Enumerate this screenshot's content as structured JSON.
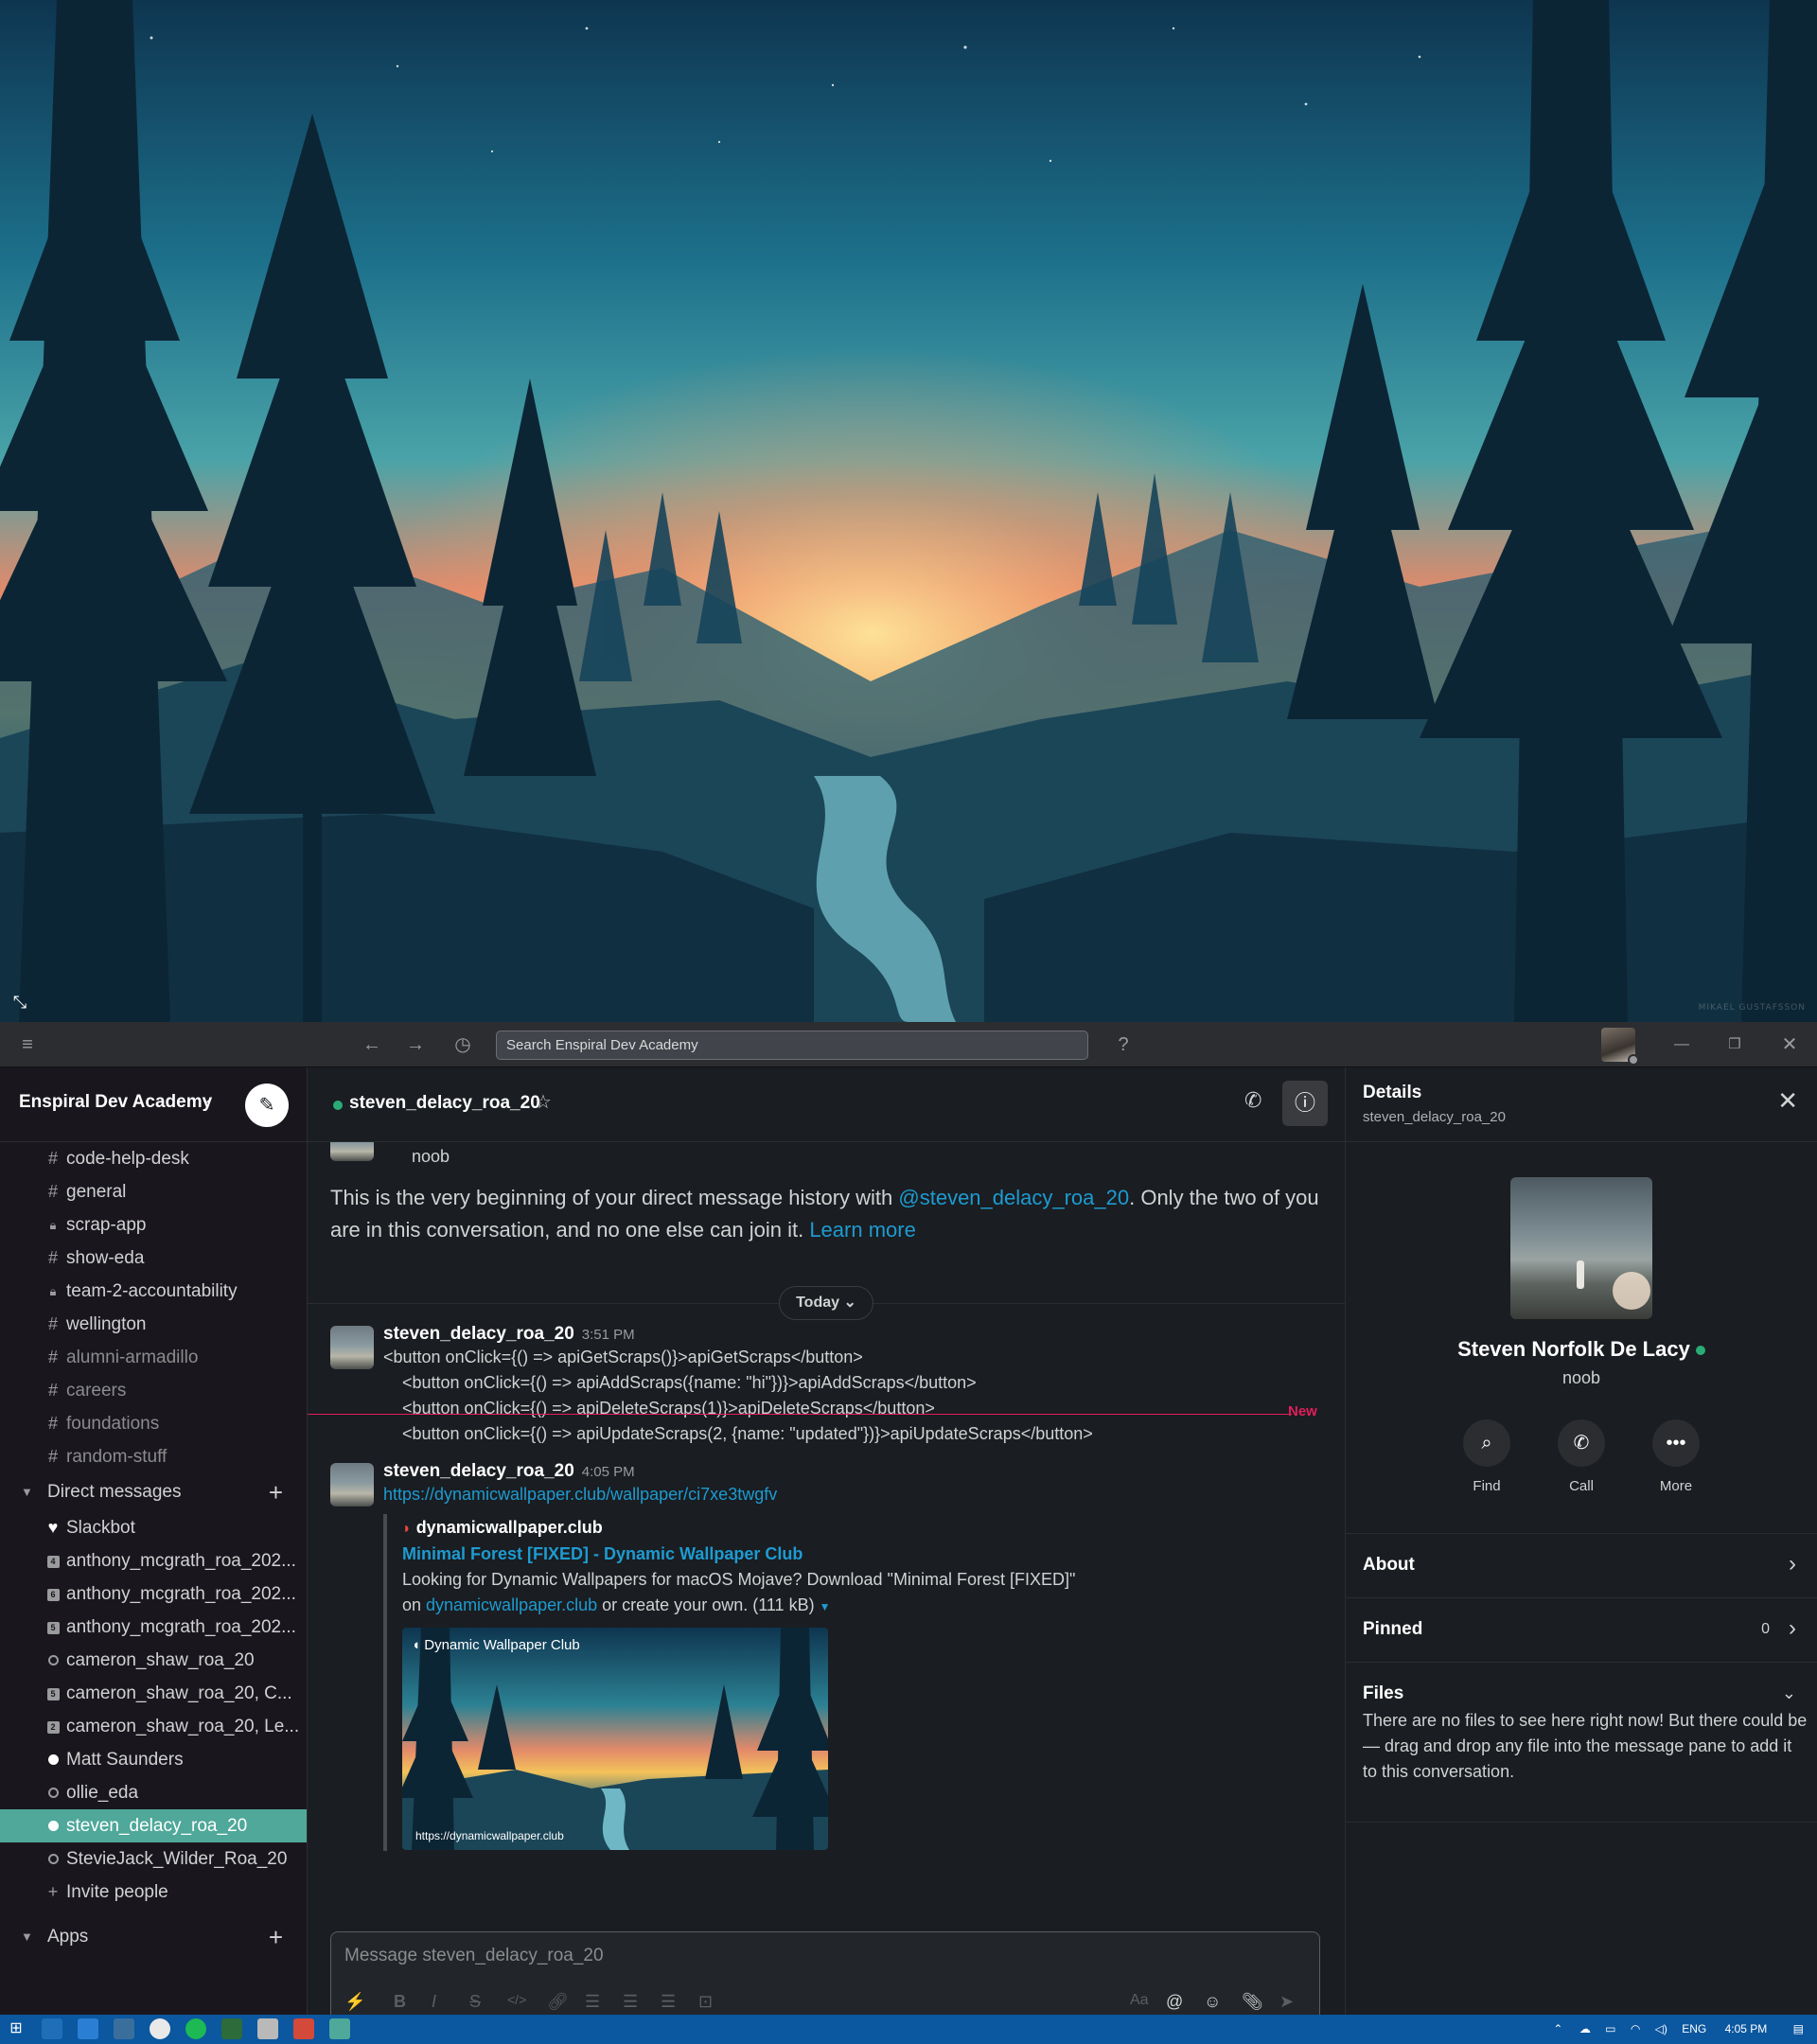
{
  "wallpaper": {
    "credit": "MIKAEL GUSTAFSSON"
  },
  "titlebar": {
    "search_placeholder": "Search Enspiral Dev Academy",
    "icons": [
      "hamburger-icon",
      "back-icon",
      "forward-icon",
      "history-icon",
      "help-icon",
      "minimize-icon",
      "restore-icon",
      "close-icon"
    ]
  },
  "sidebar": {
    "workspace_name": "Enspiral Dev Academy",
    "channels": [
      {
        "prefix": "#",
        "label": "code-help-desk",
        "muted": false
      },
      {
        "prefix": "#",
        "label": "general",
        "muted": false
      },
      {
        "prefix": "lock",
        "label": "scrap-app",
        "muted": false
      },
      {
        "prefix": "#",
        "label": "show-eda",
        "muted": false
      },
      {
        "prefix": "lock",
        "label": "team-2-accountability",
        "muted": false
      },
      {
        "prefix": "#",
        "label": "wellington",
        "muted": false
      },
      {
        "prefix": "#",
        "label": "alumni-armadillo",
        "muted": true
      },
      {
        "prefix": "#",
        "label": "careers",
        "muted": true
      },
      {
        "prefix": "#",
        "label": "foundations",
        "muted": true
      },
      {
        "prefix": "#",
        "label": "random-stuff",
        "muted": true
      }
    ],
    "dm_section": "Direct messages",
    "dms": [
      {
        "kind": "heart",
        "badge": "",
        "label": "Slackbot"
      },
      {
        "kind": "badge",
        "badge": "4",
        "label": "anthony_mcgrath_roa_202..."
      },
      {
        "kind": "badge",
        "badge": "6",
        "label": "anthony_mcgrath_roa_202..."
      },
      {
        "kind": "badge",
        "badge": "5",
        "label": "anthony_mcgrath_roa_202..."
      },
      {
        "kind": "away",
        "badge": "",
        "label": "cameron_shaw_roa_20"
      },
      {
        "kind": "badge",
        "badge": "5",
        "label": "cameron_shaw_roa_20, C..."
      },
      {
        "kind": "badge",
        "badge": "2",
        "label": "cameron_shaw_roa_20, Le..."
      },
      {
        "kind": "online",
        "badge": "",
        "label": "Matt Saunders"
      },
      {
        "kind": "away",
        "badge": "",
        "label": "ollie_eda"
      },
      {
        "kind": "online",
        "badge": "",
        "label": "steven_delacy_roa_20",
        "active": true
      },
      {
        "kind": "away",
        "badge": "",
        "label": "StevieJack_Wilder_Roa_20"
      }
    ],
    "invite": "Invite people",
    "apps_section": "Apps"
  },
  "channel": {
    "name": "steven_delacy_roa_20",
    "partial_top_text": "noob",
    "intro_before": "This is the very beginning of your direct message history with ",
    "intro_mention": "@steven_delacy_roa_20",
    "intro_after": ". Only the two of you are in this conversation, and no one else can join it. ",
    "intro_link": "Learn more",
    "date_divider": "Today",
    "new_label": "New",
    "messages": [
      {
        "author": "steven_delacy_roa_20",
        "time": "3:51 PM",
        "lines": [
          "<button onClick={() => apiGetScraps()}>apiGetScraps</button>",
          "    <button onClick={() => apiAddScraps({name: \"hi\"})}>apiAddScraps</button>",
          "    <button onClick={() => apiDeleteScraps(1)}>apiDeleteScraps</button>",
          "    <button onClick={() => apiUpdateScraps(2, {name: \"updated\"})}>apiUpdateScraps</button>"
        ]
      },
      {
        "author": "steven_delacy_roa_20",
        "time": "4:05 PM",
        "url": "https://dynamicwallpaper.club/wallpaper/ci7xe3twgfv",
        "unfurl": {
          "site": "dynamicwallpaper.club",
          "title": "Minimal Forest [FIXED] - Dynamic Wallpaper Club",
          "desc_before": "Looking for Dynamic Wallpapers for macOS Mojave? Download \"Minimal Forest [FIXED]\" on ",
          "desc_link": "dynamicwallpaper.club",
          "desc_after": " or create your own. (111 kB)",
          "image_caption": "Dynamic Wallpaper Club",
          "image_url": "https://dynamicwallpaper.club"
        }
      }
    ],
    "composer_placeholder": "Message steven_delacy_roa_20"
  },
  "details": {
    "title": "Details",
    "subtitle": "steven_delacy_roa_20",
    "name": "Steven Norfolk De Lacy",
    "status_title": "noob",
    "actions": [
      "Find",
      "Call",
      "More"
    ],
    "about": "About",
    "pinned": "Pinned",
    "pinned_count": "0",
    "files": "Files",
    "files_empty": "There are no files to see here right now! But there could be — drag and drop any file into the message pane to add it to this conversation."
  },
  "taskbar": {
    "lang": "ENG",
    "time": "4:05 PM"
  },
  "colors": {
    "accent": "#4fa89a",
    "link": "#1d9bd1",
    "online": "#2bac76",
    "new": "#e01e5a",
    "taskbar": "#0b57a0"
  }
}
